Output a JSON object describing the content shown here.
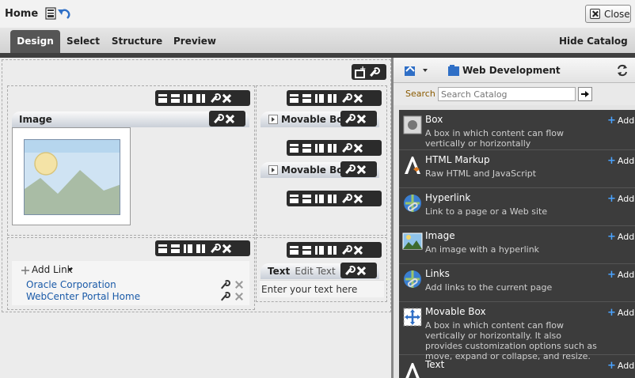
{
  "header": {
    "title": "Home",
    "close_label": "Close"
  },
  "tabs": [
    {
      "label": "Design",
      "active": true
    },
    {
      "label": "Select"
    },
    {
      "label": "Structure"
    },
    {
      "label": "Preview"
    }
  ],
  "hide_catalog_label": "Hide Catalog",
  "canvas": {
    "image_title": "Image",
    "movable_box_1": "Movable Box",
    "movable_box_2": "Movable Box",
    "add_link_label": "Add Link",
    "links": [
      "Oracle Corporation",
      "WebCenter Portal Home"
    ],
    "text_title": "Text",
    "edit_text_label": "Edit Text",
    "text_content": "Enter your text here"
  },
  "catalog": {
    "breadcrumb": "Web Development",
    "search_label": "Search",
    "search_placeholder": "Search Catalog",
    "add_label": "Add",
    "items": [
      {
        "name": "Box",
        "desc": "A box in which content can flow vertically or horizontally",
        "icon": "box-icon"
      },
      {
        "name": "HTML Markup",
        "desc": "Raw HTML and JavaScript",
        "icon": "html-markup-icon"
      },
      {
        "name": "Hyperlink",
        "desc": "Link to a page or a Web site",
        "icon": "hyperlink-icon"
      },
      {
        "name": "Image",
        "desc": "An image with a hyperlink",
        "icon": "image-icon"
      },
      {
        "name": "Links",
        "desc": "Add links to the current page",
        "icon": "links-icon"
      },
      {
        "name": "Movable Box",
        "desc": "A box in which content can flow vertically or horizontally. It also provides customization options such as move, expand or collapse, and resize.",
        "icon": "movable-box-icon"
      },
      {
        "name": "Text",
        "desc": "",
        "icon": "text-icon"
      }
    ]
  },
  "colors": {
    "active_tab": "#555555",
    "catalog_list_bg": "#3c3c3c",
    "link": "#1a5aa8",
    "add_plus": "#4aa3ff"
  }
}
